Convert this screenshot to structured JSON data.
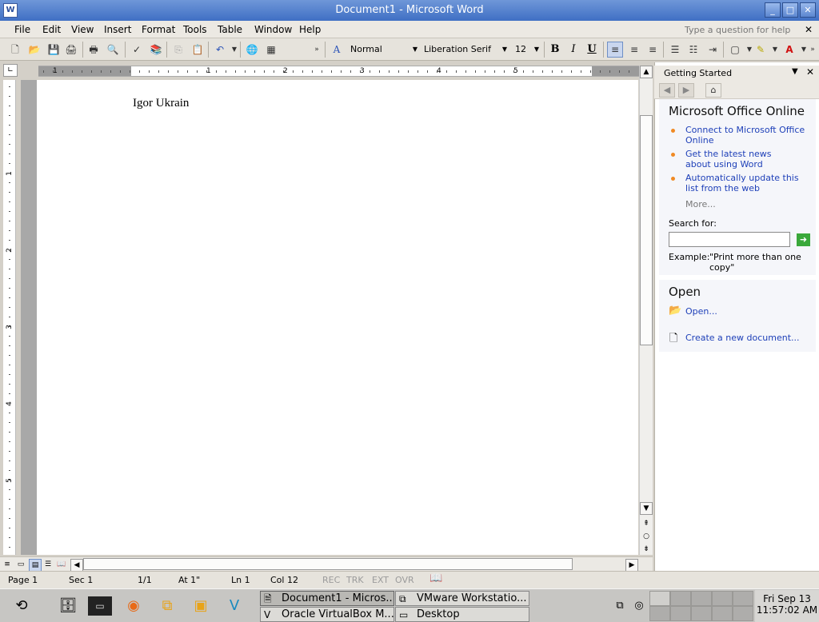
{
  "window": {
    "title": "Document1 - Microsoft Word",
    "app_icon": "W"
  },
  "menu": {
    "items": [
      "File",
      "Edit",
      "View",
      "Insert",
      "Format",
      "Tools",
      "Table",
      "Window",
      "Help"
    ],
    "help_placeholder": "Type a question for help"
  },
  "toolbar": {
    "style": "Normal",
    "font": "Liberation Serif",
    "size": "12",
    "bold": "B",
    "italic": "I",
    "underline": "U"
  },
  "ruler": {
    "numbers": [
      "1",
      "1",
      "2",
      "3",
      "4",
      "5"
    ]
  },
  "vruler": {
    "numbers": [
      "1",
      "2",
      "3",
      "4",
      "5"
    ]
  },
  "document": {
    "text": "Igor Ukrain"
  },
  "status": {
    "page": "Page  1",
    "sec": "Sec  1",
    "pages": "1/1",
    "at": "At  1\"",
    "ln": "Ln  1",
    "col": "Col  12",
    "rec": "REC",
    "trk": "TRK",
    "ext": "EXT",
    "ovr": "OVR"
  },
  "taskpane": {
    "title": "Getting Started",
    "section1": {
      "heading": "Microsoft Office Online",
      "links": [
        "Connect to Microsoft Office Online",
        "Get the latest news about using Word",
        "Automatically update this list from the web"
      ],
      "more": "More...",
      "search_label": "Search for:",
      "example_label": "Example:",
      "example_text": "\"Print more than one copy\""
    },
    "section2": {
      "heading": "Open",
      "open_link": "Open...",
      "create_link": "Create a new document..."
    }
  },
  "taskbar": {
    "tasks": [
      {
        "label": "Document1 - Micros..."
      },
      {
        "label": "VMware Workstatio..."
      },
      {
        "label": "Oracle VirtualBox M..."
      },
      {
        "label": "Desktop"
      }
    ],
    "clock": {
      "date": "Fri Sep 13",
      "time": "11:57:02 AM"
    }
  },
  "colors": {
    "title_bar": "#4f7ccc",
    "link": "#1d3fb8",
    "bullet": "#f08a24"
  }
}
